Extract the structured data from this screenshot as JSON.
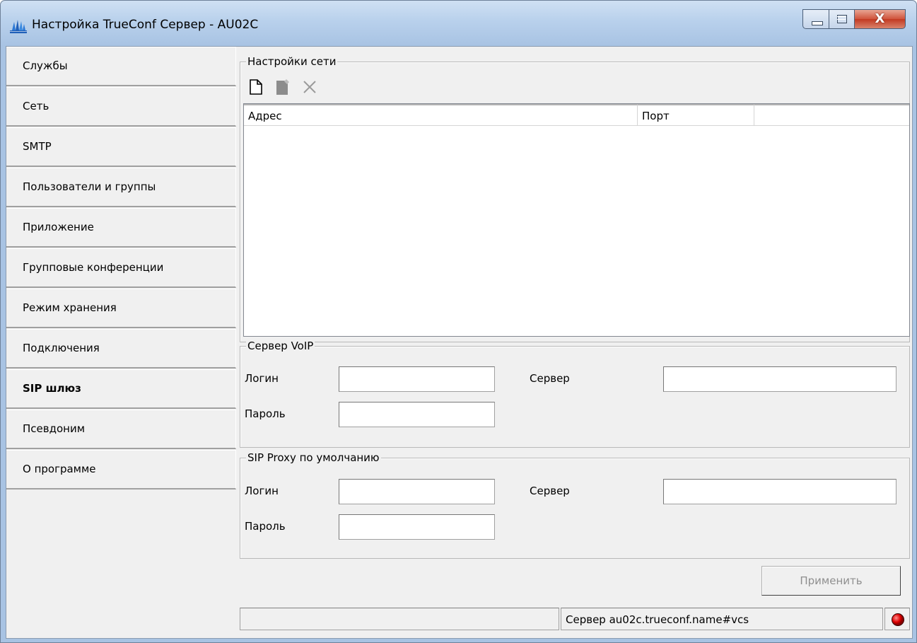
{
  "window": {
    "title": "Настройка TrueConf Сервер - AU02C",
    "close_glyph": "X"
  },
  "sidebar": {
    "items": [
      {
        "label": "Службы"
      },
      {
        "label": "Сеть"
      },
      {
        "label": "SMTP"
      },
      {
        "label": "Пользователи и группы"
      },
      {
        "label": "Приложение"
      },
      {
        "label": "Групповые конференции"
      },
      {
        "label": "Режим хранения"
      },
      {
        "label": "Подключения"
      },
      {
        "label": "SIP шлюз",
        "active": true
      },
      {
        "label": "Псевдоним"
      },
      {
        "label": "О программе"
      }
    ]
  },
  "network": {
    "legend": "Настройки сети",
    "toolbar_icons": [
      "new-document-icon",
      "edit-icon",
      "delete-icon"
    ],
    "columns": [
      "Адрес",
      "Порт",
      ""
    ],
    "rows": []
  },
  "voip": {
    "legend": "Сервер VoIP",
    "login_label": "Логин",
    "login_value": "",
    "password_label": "Пароль",
    "password_value": "",
    "server_label": "Сервер",
    "server_value": ""
  },
  "proxy": {
    "legend": "SIP Proxy по умолчанию",
    "login_label": "Логин",
    "login_value": "",
    "password_label": "Пароль",
    "password_value": "",
    "server_label": "Сервер",
    "server_value": ""
  },
  "actions": {
    "apply_label": "Применить"
  },
  "status": {
    "left": "",
    "server": "Сервер au02c.trueconf.name#vcs",
    "indicator_color": "#e00000"
  }
}
